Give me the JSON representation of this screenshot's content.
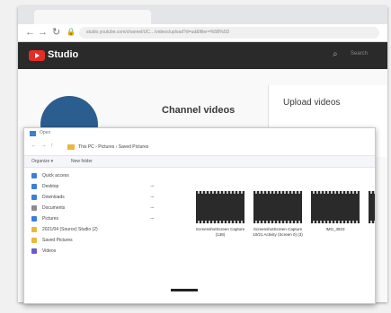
{
  "browser": {
    "url": "studio.youtube.com/channel/UC…/videos/upload?d=ud&filter=%5B%5D"
  },
  "studio": {
    "logo_text": "Studio",
    "search_placeholder": "Search",
    "page_title": "Channel videos",
    "upload_dialog_title": "Upload videos"
  },
  "file_dialog": {
    "title": "Open",
    "breadcrumb": "This PC  ›  Pictures  ›  Saved Pictures",
    "organize_label": "Organize ▾",
    "new_folder_label": "New folder",
    "sidebar": [
      {
        "label": "Quick access",
        "color": "#3c7fd6",
        "pinned": false
      },
      {
        "label": "Desktop",
        "color": "#3c7fd6",
        "pinned": true
      },
      {
        "label": "Downloads",
        "color": "#3c7fd6",
        "pinned": true
      },
      {
        "label": "Documents",
        "color": "#8c8c8c",
        "pinned": true
      },
      {
        "label": "Pictures",
        "color": "#3c7fd6",
        "pinned": true
      },
      {
        "label": "2021/04 (Source) Studio (2)",
        "color": "#e8b840",
        "pinned": false
      },
      {
        "label": "Saved Pictures",
        "color": "#e8b840",
        "pinned": false
      },
      {
        "label": "Videos",
        "color": "#6a5acd",
        "pinned": false
      }
    ],
    "files": [
      {
        "name": "ScreenshotScreen Capture (138)"
      },
      {
        "name": "ScreenshotScreen Capture 10/21 Activity (Screen 0) (3)"
      },
      {
        "name": "IMG_3823"
      },
      {
        "name": ""
      }
    ]
  }
}
